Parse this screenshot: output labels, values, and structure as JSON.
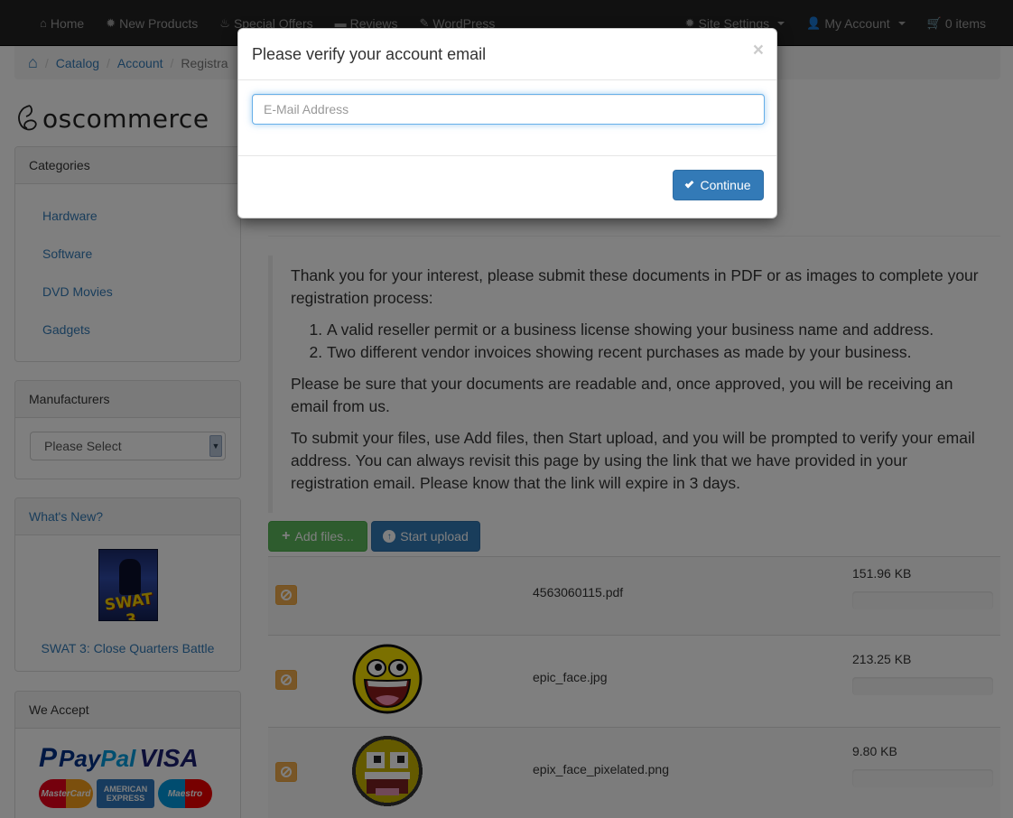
{
  "navbar": {
    "left": [
      {
        "label": "Home",
        "icon": "home-icon",
        "glyph": "⌂"
      },
      {
        "label": "New Products",
        "icon": "gear-icon",
        "glyph": "✹"
      },
      {
        "label": "Special Offers",
        "icon": "fire-icon",
        "glyph": "♨"
      },
      {
        "label": "Reviews",
        "icon": "comment-icon",
        "glyph": "▬"
      },
      {
        "label": "WordPress",
        "icon": "pencil-icon",
        "glyph": "✎"
      }
    ],
    "right": [
      {
        "label": "Site Settings",
        "icon": "cog-icon",
        "glyph": "✹"
      },
      {
        "label": "My Account",
        "icon": "user-icon",
        "glyph": "👤"
      },
      {
        "label": "0 items",
        "icon": "cart-icon",
        "glyph": "🛒"
      }
    ]
  },
  "breadcrumb": {
    "home_glyph": "⌂",
    "items": [
      "Catalog",
      "Account",
      "Registra"
    ]
  },
  "logo": {
    "text": "oscommerce"
  },
  "categories": {
    "heading": "Categories",
    "items": [
      "Hardware",
      "Software",
      "DVD Movies",
      "Gadgets"
    ]
  },
  "manufacturers": {
    "heading": "Manufacturers",
    "select_value": "Please Select"
  },
  "whats_new": {
    "heading": "What's New?",
    "cover_title": "SWAT 3",
    "product": "SWAT 3: Close Quarters Battle"
  },
  "we_accept": {
    "heading": "We Accept",
    "paypal_pay": "Pay",
    "paypal_pal": "Pal",
    "visa": "VISA",
    "mastercard": "MasterCard",
    "amex": "AMERICAN EXPRESS",
    "maestro": "Maestro"
  },
  "instructions": {
    "intro": "Thank you for your interest, please submit these documents in PDF or as images to complete your registration process:",
    "items": [
      "A valid reseller permit or a business license showing your business name and address.",
      "Two different vendor invoices showing recent purchases as made by your business."
    ],
    "note": "Please be sure that your documents are readable and, once approved, you will be receiving an email from us.",
    "submit": "To submit your files, use Add files, then Start upload, and you will be prompted to verify your email address. You can always revisit this page by using the link that we have provided in your registration email. Please know that the link will expire in 3 days."
  },
  "uploader": {
    "add_label": "Add files...",
    "start_label": "Start upload",
    "files": [
      {
        "name": "4563060115.pdf",
        "size": "151.96 KB",
        "progress": 0,
        "thumb": "none"
      },
      {
        "name": "epic_face.jpg",
        "size": "213.25 KB",
        "progress": 0,
        "thumb": "smiley"
      },
      {
        "name": "epix_face_pixelated.png",
        "size": "9.80 KB",
        "progress": 0,
        "thumb": "smiley-pixel"
      }
    ]
  },
  "modal": {
    "title": "Please verify your account email",
    "close": "×",
    "email_placeholder": "E-Mail Address",
    "email_value": "",
    "continue_label": "Continue"
  },
  "colors": {
    "navbar_bg": "#222222",
    "primary": "#337ab7",
    "success": "#5cb85c",
    "warning": "#f0ad4e"
  }
}
